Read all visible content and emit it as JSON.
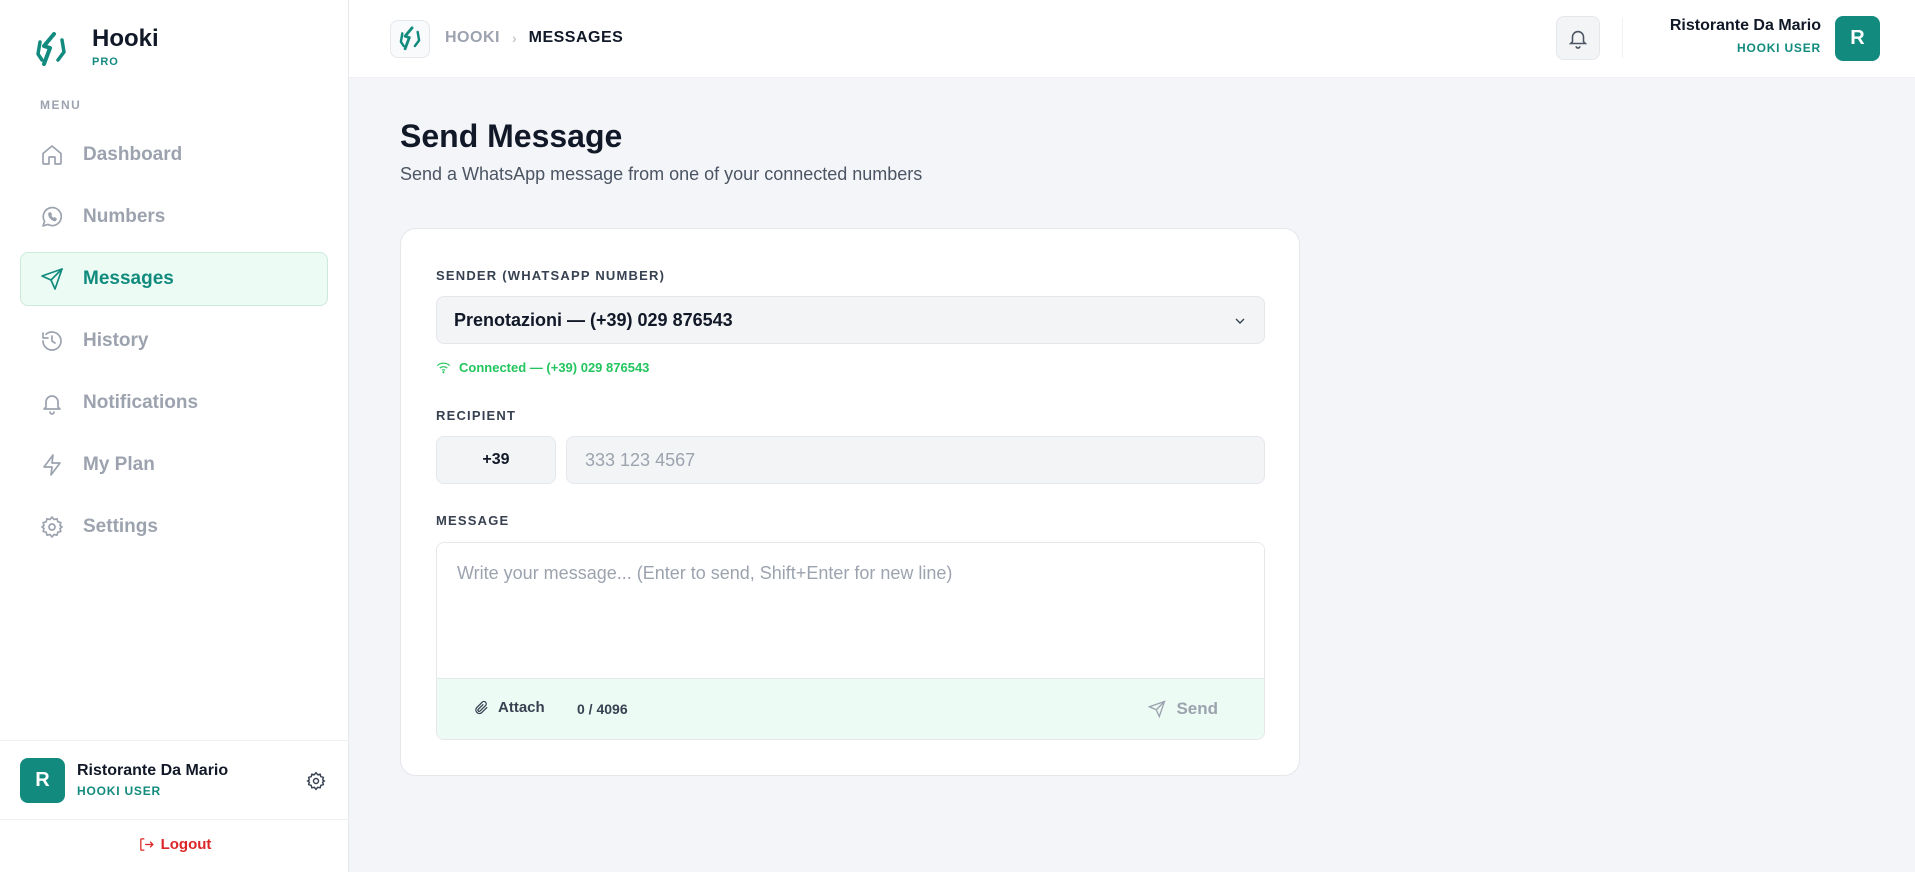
{
  "brand": {
    "name": "Hooki",
    "tier": "PRO",
    "logo_icon": "hooki-logo-icon"
  },
  "colors": {
    "accent": "#128b7e",
    "active_bg": "#ecfbf3",
    "success": "#22c55e",
    "danger": "#dc2626"
  },
  "sidebar": {
    "menu_label": "MENU",
    "items": [
      {
        "label": "Dashboard",
        "icon": "home-icon",
        "active": false
      },
      {
        "label": "Numbers",
        "icon": "whatsapp-icon",
        "active": false
      },
      {
        "label": "Messages",
        "icon": "send-icon",
        "active": true
      },
      {
        "label": "History",
        "icon": "history-icon",
        "active": false
      },
      {
        "label": "Notifications",
        "icon": "bell-icon",
        "active": false
      },
      {
        "label": "My Plan",
        "icon": "lightning-icon",
        "active": false
      },
      {
        "label": "Settings",
        "icon": "gear-icon",
        "active": false
      }
    ],
    "user": {
      "initial": "R",
      "name": "Ristorante Da Mario",
      "role": "HOOKI USER"
    },
    "logout_label": "Logout"
  },
  "header": {
    "breadcrumb_root": "HOOKI",
    "breadcrumb_current": "MESSAGES",
    "user": {
      "initial": "R",
      "name": "Ristorante Da Mario",
      "role": "HOOKI USER"
    }
  },
  "main": {
    "title": "Send Message",
    "subtitle": "Send a WhatsApp message from one of your connected numbers",
    "sender_label": "SENDER (WHATSAPP NUMBER)",
    "sender_value": "Prenotazioni — (+39) 029 876543",
    "sender_status": "Connected — (+39) 029 876543",
    "recipient_label": "RECIPIENT",
    "country_code": "+39",
    "phone_placeholder": "333 123 4567",
    "message_label": "MESSAGE",
    "message_placeholder": "Write your message... (Enter to send, Shift+Enter for new line)",
    "attach_label": "Attach",
    "char_count": "0 / 4096",
    "send_label": "Send"
  }
}
